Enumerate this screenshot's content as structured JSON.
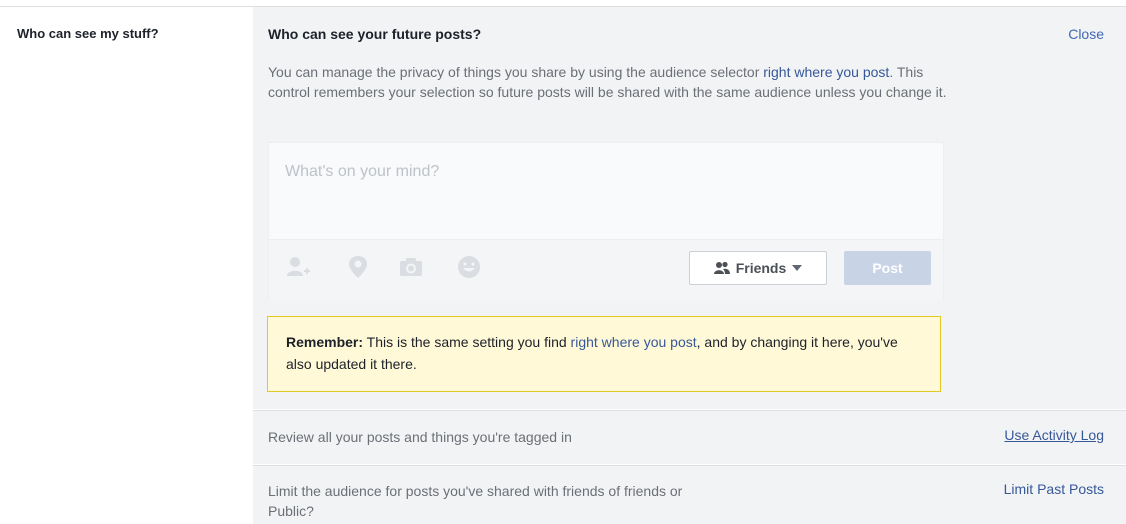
{
  "section_label": "Who can see my stuff?",
  "panel": {
    "title": "Who can see your future posts?",
    "close_label": "Close",
    "description_part1": "You can manage the privacy of things you share by using the audience selector ",
    "description_link": "right where you post",
    "description_part2": ". This control remembers your selection so future posts will be shared with the same audience unless you change it."
  },
  "composer": {
    "placeholder": "What's on your mind?",
    "icons": [
      "tag-people-icon",
      "location-pin-icon",
      "camera-icon",
      "emoji-icon"
    ],
    "audience_label": "Friends",
    "post_label": "Post"
  },
  "remember": {
    "bold": "Remember:",
    "text1": " This is the same setting you find ",
    "link": "right where you post",
    "text2": ", and by changing it here, you've also updated it there."
  },
  "rows": [
    {
      "text": "Review all your posts and things you're tagged in",
      "action": "Use Activity Log"
    },
    {
      "text": "Limit the audience for posts you've shared with friends of friends or Public?",
      "action": "Limit Past Posts"
    }
  ],
  "colors": {
    "link": "#365899",
    "panel_bg": "#f2f3f5",
    "warning_bg": "#fff9d7",
    "warning_border": "#e2c822",
    "post_disabled": "#c9d3e6"
  }
}
